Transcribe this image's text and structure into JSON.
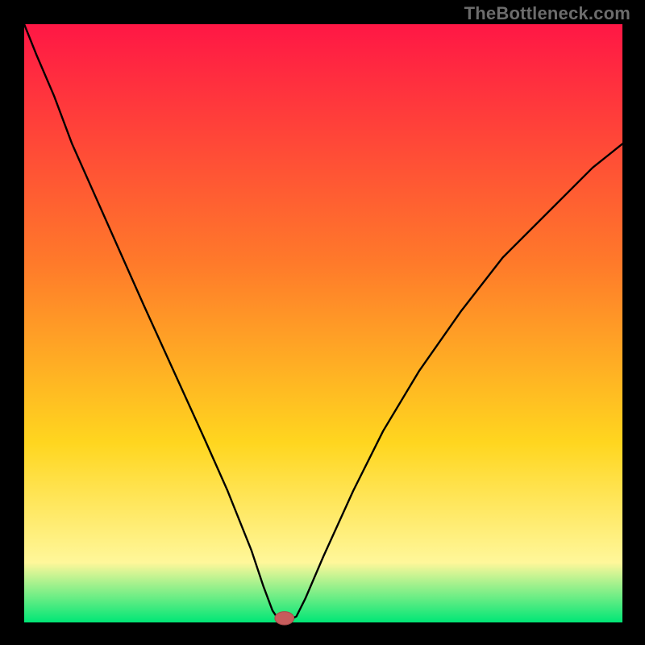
{
  "watermark": "TheBottleneck.com",
  "colors": {
    "background": "#000000",
    "gradient_top": "#ff1745",
    "gradient_mid1": "#ff7a2a",
    "gradient_mid2": "#ffd61f",
    "gradient_mid3": "#fff79a",
    "gradient_bottom": "#00e676",
    "curve": "#000000",
    "marker_fill": "#c75c5c",
    "marker_stroke": "#a84a4a"
  },
  "plot": {
    "inner_x": 30,
    "inner_y": 30,
    "inner_w": 742,
    "inner_h": 742,
    "gradient_stops": [
      {
        "offset": 0.0,
        "color_key": "gradient_top"
      },
      {
        "offset": 0.4,
        "color_key": "gradient_mid1"
      },
      {
        "offset": 0.7,
        "color_key": "gradient_mid2"
      },
      {
        "offset": 0.9,
        "color_key": "gradient_mid3"
      },
      {
        "offset": 1.0,
        "color_key": "gradient_bottom"
      }
    ]
  },
  "chart_data": {
    "type": "line",
    "title": "",
    "xlabel": "",
    "ylabel": "",
    "xlim": [
      0,
      100
    ],
    "ylim": [
      0,
      100
    ],
    "x": [
      0,
      2,
      5,
      8,
      12,
      16,
      20,
      25,
      30,
      34,
      38,
      40,
      41.5,
      42.5,
      44.5,
      45.5,
      47,
      50,
      55,
      60,
      66,
      73,
      80,
      88,
      95,
      100
    ],
    "values": [
      100,
      95,
      88,
      80,
      71,
      62,
      53,
      42,
      31,
      22,
      12,
      6,
      2,
      0.5,
      0.5,
      1,
      4,
      11,
      22,
      32,
      42,
      52,
      61,
      69,
      76,
      80
    ],
    "marker": {
      "x": 43.5,
      "y": 0.7,
      "rx": 1.6,
      "ry": 1.1
    }
  }
}
